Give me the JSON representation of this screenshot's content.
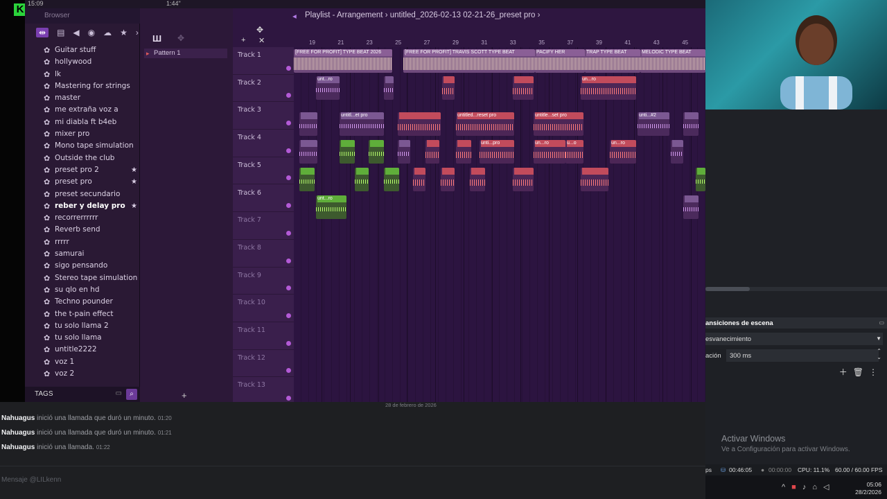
{
  "stream": {
    "logo_letter": "K",
    "count": "3"
  },
  "fl_top": {
    "time": "15:09",
    "beat": "1:44\""
  },
  "browser": {
    "title": "Browser",
    "files": [
      {
        "name": "Guitar stuff",
        "star": false,
        "highlight": false
      },
      {
        "name": "hollywood",
        "star": false,
        "highlight": false
      },
      {
        "name": "lk",
        "star": false,
        "highlight": false
      },
      {
        "name": "Mastering for strings",
        "star": false,
        "highlight": false
      },
      {
        "name": "master",
        "star": false,
        "highlight": false
      },
      {
        "name": "me extraña voz a",
        "star": false,
        "highlight": false
      },
      {
        "name": "mi diabla ft b4eb",
        "star": false,
        "highlight": false
      },
      {
        "name": "mixer pro",
        "star": false,
        "highlight": false
      },
      {
        "name": "Mono tape simulation",
        "star": false,
        "highlight": false
      },
      {
        "name": "Outside the club",
        "star": false,
        "highlight": false
      },
      {
        "name": "preset pro 2",
        "star": true,
        "highlight": false
      },
      {
        "name": "preset pro",
        "star": true,
        "highlight": false
      },
      {
        "name": "preset secundario",
        "star": false,
        "highlight": false
      },
      {
        "name": "reber y delay pro",
        "star": true,
        "highlight": true
      },
      {
        "name": "recorrerrrrrr",
        "star": false,
        "highlight": false
      },
      {
        "name": "Reverb send",
        "star": false,
        "highlight": false
      },
      {
        "name": "rrrrr",
        "star": false,
        "highlight": false
      },
      {
        "name": "samurai",
        "star": false,
        "highlight": false
      },
      {
        "name": "sigo pensando",
        "star": false,
        "highlight": false
      },
      {
        "name": "Stereo tape simulation",
        "star": false,
        "highlight": false
      },
      {
        "name": "su qlo en hd",
        "star": false,
        "highlight": false
      },
      {
        "name": "Techno pounder",
        "star": false,
        "highlight": false
      },
      {
        "name": "the t-pain effect",
        "star": false,
        "highlight": false
      },
      {
        "name": "tu solo llama 2",
        "star": false,
        "highlight": false
      },
      {
        "name": "tu solo llama",
        "star": false,
        "highlight": false
      },
      {
        "name": "untitle2222",
        "star": false,
        "highlight": false
      },
      {
        "name": "voz 1",
        "star": false,
        "highlight": false
      },
      {
        "name": "voz 2",
        "star": false,
        "highlight": false
      }
    ],
    "tags_label": "TAGS"
  },
  "patterns": {
    "items": [
      "Pattern 1"
    ]
  },
  "playlist": {
    "title": "Playlist - Arrangement",
    "project": "untitled_2026-02-13 02-21-26_preset pro",
    "ruler": [
      "19",
      "21",
      "23",
      "25",
      "27",
      "29",
      "31",
      "33",
      "35",
      "37",
      "39",
      "41",
      "43",
      "45"
    ],
    "tracks": [
      "Track 1",
      "Track 2",
      "Track 3",
      "Track 4",
      "Track 5",
      "Track 6",
      "Track 7",
      "Track 8",
      "Track 9",
      "Track 10",
      "Track 11",
      "Track 12",
      "Track 13"
    ],
    "clip_labels": {
      "t1a": "[FREE FOR PROFIT] TYPE BEAT 2026",
      "t1b": "[FREE FOR PROFIT] TRAVIS SCOTT TYPE BEAT",
      "t1c": "PACIFY HER",
      "t1d": "TRAP TYPE BEAT",
      "t1e": "MELODIC TYPE BEAT",
      "t2a": "unt...ro",
      "t2b": "un...ro",
      "t3a": "untitl...et pro",
      "t3b": "untitled...reset pro",
      "t3c": "untitle...set pro",
      "t3d": "unti...#2",
      "t4a": "unti...pro",
      "t4b": "un...ro",
      "t4c": "u...o",
      "t4d": "un...ro",
      "t6a": "unt...ro"
    }
  },
  "obs": {
    "transitions_title": "ansiciones de escena",
    "transition_value": "esvanecimiento",
    "duration_label": "ación",
    "duration_value": "300 ms",
    "activate_title": "Activar Windows",
    "activate_sub": "Ve a Configuración para activar Windows.",
    "status": {
      "fps_suffix": "ps",
      "rec_time": "00:46:05",
      "stream_time": "00:00:00",
      "cpu": "CPU: 11.1%",
      "fps": "60.00 / 60.00 FPS"
    }
  },
  "taskbar": {
    "time": "05:06",
    "date": "28/2/2026"
  },
  "chat": {
    "date_divider": "28 de febrero de 2026",
    "messages": [
      {
        "user": "Nahuagus",
        "text": " inició una llamada que duró un minuto. ",
        "time": "01:20"
      },
      {
        "user": "Nahuagus",
        "text": " inició una llamada que duró un minuto. ",
        "time": "01:21"
      },
      {
        "user": "Nahuagus",
        "text": " inició una llamada. ",
        "time": "01:22"
      }
    ],
    "input_placeholder": "Mensaje @LILkenn"
  }
}
